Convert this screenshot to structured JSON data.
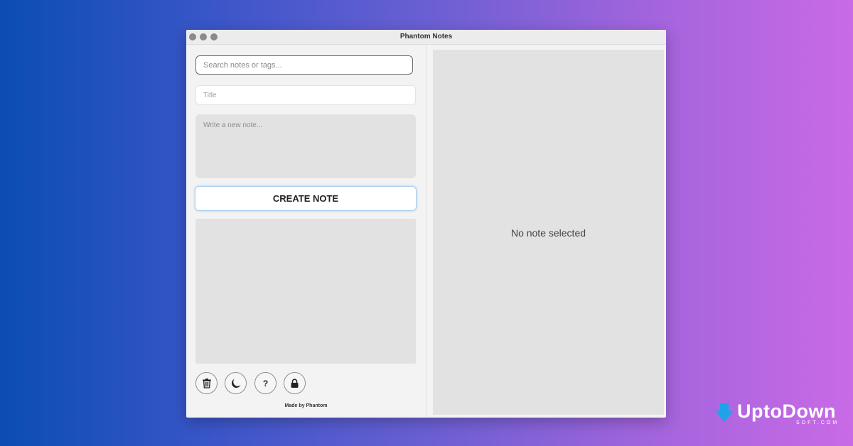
{
  "window": {
    "title": "Phantom Notes"
  },
  "search": {
    "placeholder": "Search notes or tags..."
  },
  "editor": {
    "title_placeholder": "Title",
    "body_placeholder": "Write a new note...",
    "create_label": "CREATE NOTE"
  },
  "toolbar": {
    "help_label": "?",
    "icons": [
      "trash-icon",
      "moon-icon",
      "help-icon",
      "lock-icon"
    ]
  },
  "footer": {
    "made_by": "Made by Phantom"
  },
  "detail": {
    "empty_text": "No note selected"
  },
  "watermark": {
    "brand": "UptoDown",
    "sub": "SOFT.COM"
  },
  "colors": {
    "gradient_start": "#0b4db3",
    "gradient_end": "#c96ae6",
    "accent_outline": "#a9cdee",
    "panel": "#e2e2e2"
  }
}
